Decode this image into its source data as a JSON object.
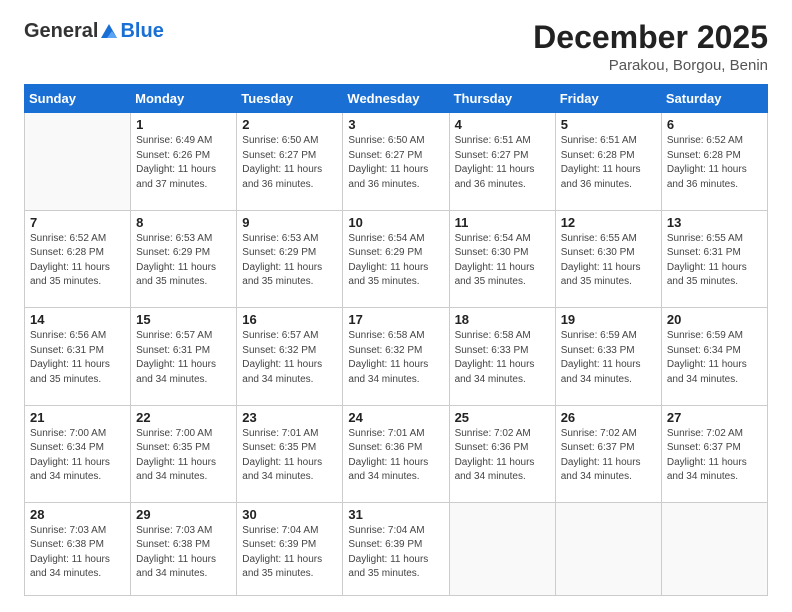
{
  "header": {
    "logo": {
      "general": "General",
      "blue": "Blue"
    },
    "title": "December 2025",
    "location": "Parakou, Borgou, Benin"
  },
  "weekdays": [
    "Sunday",
    "Monday",
    "Tuesday",
    "Wednesday",
    "Thursday",
    "Friday",
    "Saturday"
  ],
  "weeks": [
    [
      {
        "day": null
      },
      {
        "day": 1,
        "sunrise": "6:49 AM",
        "sunset": "6:26 PM",
        "daylight": "11 hours and 37 minutes."
      },
      {
        "day": 2,
        "sunrise": "6:50 AM",
        "sunset": "6:27 PM",
        "daylight": "11 hours and 36 minutes."
      },
      {
        "day": 3,
        "sunrise": "6:50 AM",
        "sunset": "6:27 PM",
        "daylight": "11 hours and 36 minutes."
      },
      {
        "day": 4,
        "sunrise": "6:51 AM",
        "sunset": "6:27 PM",
        "daylight": "11 hours and 36 minutes."
      },
      {
        "day": 5,
        "sunrise": "6:51 AM",
        "sunset": "6:28 PM",
        "daylight": "11 hours and 36 minutes."
      },
      {
        "day": 6,
        "sunrise": "6:52 AM",
        "sunset": "6:28 PM",
        "daylight": "11 hours and 36 minutes."
      }
    ],
    [
      {
        "day": 7,
        "sunrise": "6:52 AM",
        "sunset": "6:28 PM",
        "daylight": "11 hours and 35 minutes."
      },
      {
        "day": 8,
        "sunrise": "6:53 AM",
        "sunset": "6:29 PM",
        "daylight": "11 hours and 35 minutes."
      },
      {
        "day": 9,
        "sunrise": "6:53 AM",
        "sunset": "6:29 PM",
        "daylight": "11 hours and 35 minutes."
      },
      {
        "day": 10,
        "sunrise": "6:54 AM",
        "sunset": "6:29 PM",
        "daylight": "11 hours and 35 minutes."
      },
      {
        "day": 11,
        "sunrise": "6:54 AM",
        "sunset": "6:30 PM",
        "daylight": "11 hours and 35 minutes."
      },
      {
        "day": 12,
        "sunrise": "6:55 AM",
        "sunset": "6:30 PM",
        "daylight": "11 hours and 35 minutes."
      },
      {
        "day": 13,
        "sunrise": "6:55 AM",
        "sunset": "6:31 PM",
        "daylight": "11 hours and 35 minutes."
      }
    ],
    [
      {
        "day": 14,
        "sunrise": "6:56 AM",
        "sunset": "6:31 PM",
        "daylight": "11 hours and 35 minutes."
      },
      {
        "day": 15,
        "sunrise": "6:57 AM",
        "sunset": "6:31 PM",
        "daylight": "11 hours and 34 minutes."
      },
      {
        "day": 16,
        "sunrise": "6:57 AM",
        "sunset": "6:32 PM",
        "daylight": "11 hours and 34 minutes."
      },
      {
        "day": 17,
        "sunrise": "6:58 AM",
        "sunset": "6:32 PM",
        "daylight": "11 hours and 34 minutes."
      },
      {
        "day": 18,
        "sunrise": "6:58 AM",
        "sunset": "6:33 PM",
        "daylight": "11 hours and 34 minutes."
      },
      {
        "day": 19,
        "sunrise": "6:59 AM",
        "sunset": "6:33 PM",
        "daylight": "11 hours and 34 minutes."
      },
      {
        "day": 20,
        "sunrise": "6:59 AM",
        "sunset": "6:34 PM",
        "daylight": "11 hours and 34 minutes."
      }
    ],
    [
      {
        "day": 21,
        "sunrise": "7:00 AM",
        "sunset": "6:34 PM",
        "daylight": "11 hours and 34 minutes."
      },
      {
        "day": 22,
        "sunrise": "7:00 AM",
        "sunset": "6:35 PM",
        "daylight": "11 hours and 34 minutes."
      },
      {
        "day": 23,
        "sunrise": "7:01 AM",
        "sunset": "6:35 PM",
        "daylight": "11 hours and 34 minutes."
      },
      {
        "day": 24,
        "sunrise": "7:01 AM",
        "sunset": "6:36 PM",
        "daylight": "11 hours and 34 minutes."
      },
      {
        "day": 25,
        "sunrise": "7:02 AM",
        "sunset": "6:36 PM",
        "daylight": "11 hours and 34 minutes."
      },
      {
        "day": 26,
        "sunrise": "7:02 AM",
        "sunset": "6:37 PM",
        "daylight": "11 hours and 34 minutes."
      },
      {
        "day": 27,
        "sunrise": "7:02 AM",
        "sunset": "6:37 PM",
        "daylight": "11 hours and 34 minutes."
      }
    ],
    [
      {
        "day": 28,
        "sunrise": "7:03 AM",
        "sunset": "6:38 PM",
        "daylight": "11 hours and 34 minutes."
      },
      {
        "day": 29,
        "sunrise": "7:03 AM",
        "sunset": "6:38 PM",
        "daylight": "11 hours and 34 minutes."
      },
      {
        "day": 30,
        "sunrise": "7:04 AM",
        "sunset": "6:39 PM",
        "daylight": "11 hours and 35 minutes."
      },
      {
        "day": 31,
        "sunrise": "7:04 AM",
        "sunset": "6:39 PM",
        "daylight": "11 hours and 35 minutes."
      },
      {
        "day": null
      },
      {
        "day": null
      },
      {
        "day": null
      }
    ]
  ]
}
